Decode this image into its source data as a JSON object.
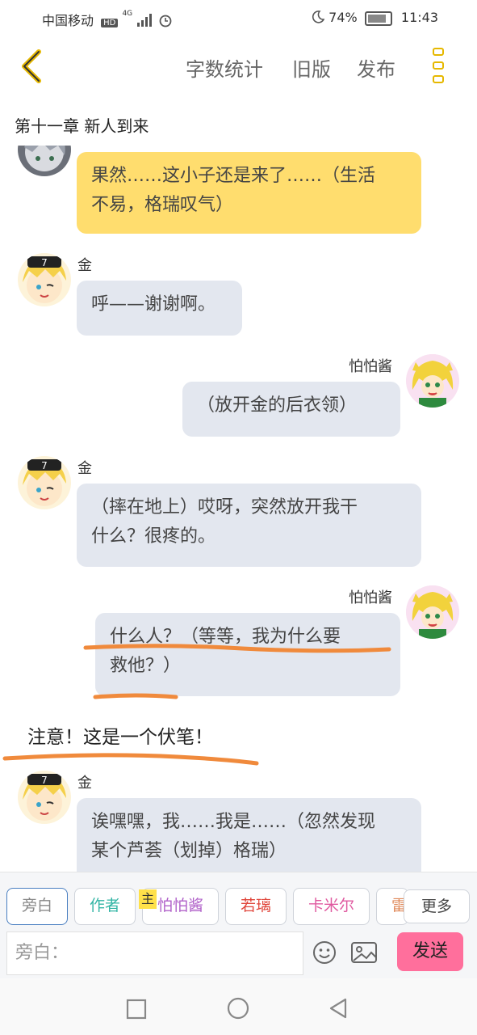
{
  "status_bar": {
    "carrier": "中国移动",
    "network_badge": "HD",
    "network_type": "4G",
    "battery_percent": "74%",
    "time": "11:43"
  },
  "toolbar": {
    "word_count": "字数统计",
    "old_version": "旧版",
    "publish": "发布"
  },
  "chapter_title": "第十一章 新人到来",
  "messages": [
    {
      "side": "left",
      "name": "",
      "text": "果然……这小子还是来了……（生活不易，格瑞叹气）",
      "lines": [
        "果然……这小子还是来了……（生活",
        "不易，格瑞叹气）"
      ],
      "highlight": true
    },
    {
      "side": "left",
      "name": "金",
      "lines": [
        "呼——谢谢啊。"
      ]
    },
    {
      "side": "right",
      "name": "怕怕酱",
      "lines": [
        "（放开金的后衣领）"
      ]
    },
    {
      "side": "left",
      "name": "金",
      "lines": [
        "（摔在地上）哎呀，突然放开我干",
        "什么？很疼的。"
      ]
    },
    {
      "side": "right",
      "name": "怕怕酱",
      "lines": [
        "什么人？（等等，我为什么要",
        "救他？）"
      ]
    },
    {
      "side": "left",
      "name": "金",
      "lines": [
        "诶嘿嘿，我……我是……（忽然发现",
        "某个芦荟（划掉）格瑞）"
      ]
    }
  ],
  "narration_note": "注意！这是一个伏笔！",
  "roles": [
    {
      "label": "旁白",
      "color": "#888888"
    },
    {
      "label": "作者",
      "color": "#33b5a5"
    },
    {
      "label": "怕怕酱",
      "color": "#b061c9"
    },
    {
      "label": "若璃",
      "color": "#e0453a"
    },
    {
      "label": "卡米尔",
      "color": "#e05aa0"
    },
    {
      "label": "雷",
      "color": "#e08a5a"
    }
  ],
  "host_badge": "主",
  "more_label": "更多",
  "input": {
    "placeholder": "旁白："
  },
  "send_label": "发送",
  "colors": {
    "accent_yellow": "#e6b800",
    "bubble_gray": "#e3e7ef",
    "bubble_yellow": "#ffdd6e",
    "send_pink": "#ff6f9c",
    "annotation_orange": "#f08a3c"
  }
}
